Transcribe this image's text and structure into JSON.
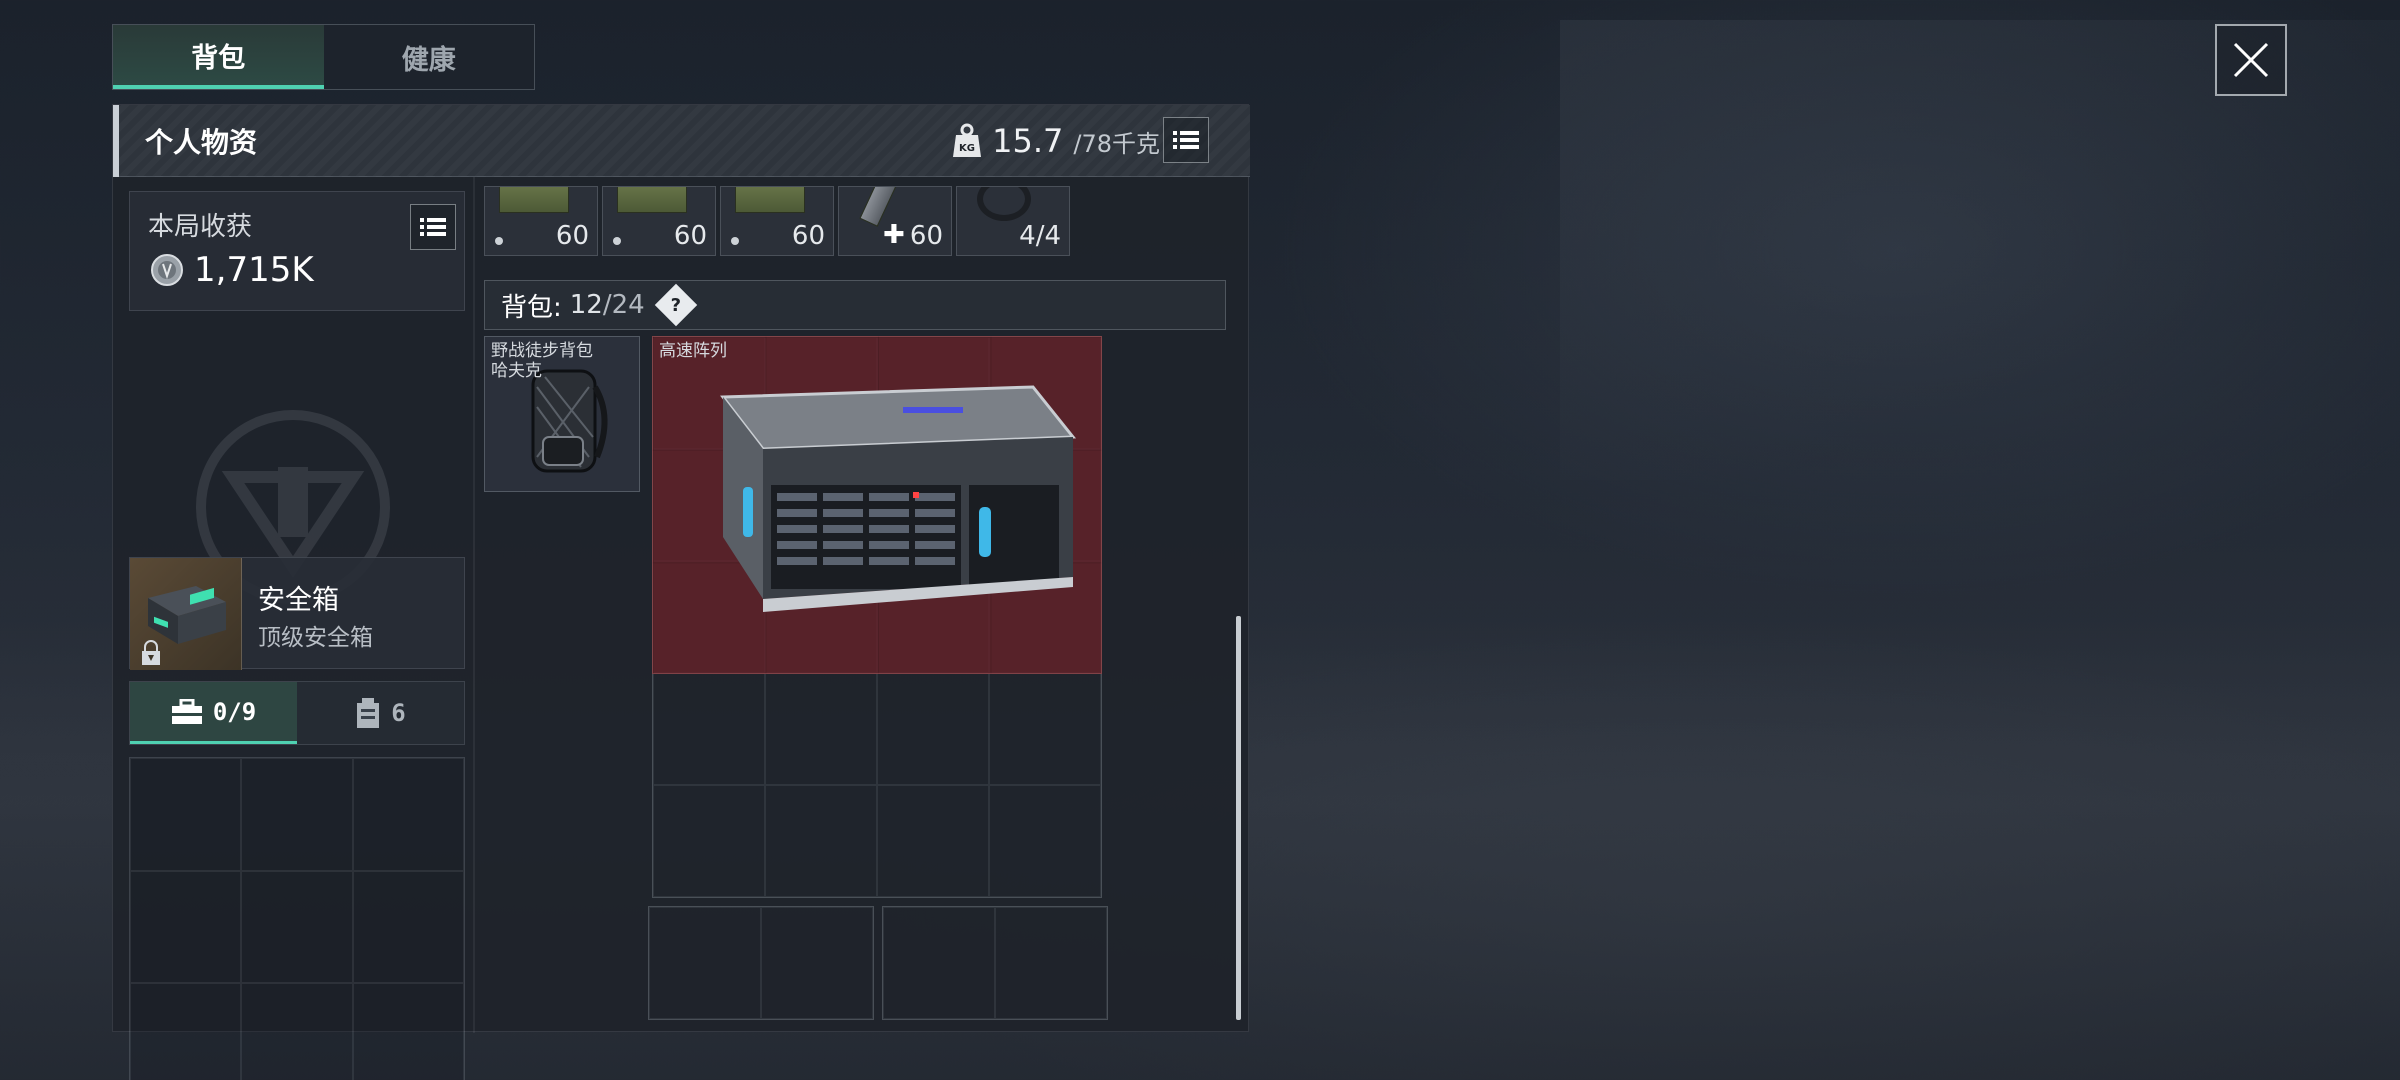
{
  "tabs": [
    {
      "label": "背包",
      "active": true
    },
    {
      "label": "健康",
      "active": false
    }
  ],
  "panel": {
    "title": "个人物资",
    "weight_current": "15.7",
    "weight_max": "/78千克"
  },
  "harvest": {
    "label": "本局收获",
    "value": "1,715K"
  },
  "safebox": {
    "name": "安全箱",
    "subtitle": "顶级安全箱"
  },
  "sub_tabs": [
    {
      "label": "0/9",
      "icon": "toolbox-icon",
      "active": true
    },
    {
      "label": "6",
      "icon": "container-icon",
      "active": false
    }
  ],
  "ammo_slots": [
    {
      "count": "60",
      "kind": "ammo"
    },
    {
      "count": "60",
      "kind": "ammo"
    },
    {
      "count": "60",
      "kind": "ammo"
    },
    {
      "count": "60",
      "kind": "medical"
    },
    {
      "count": "4/4",
      "kind": "gear"
    }
  ],
  "bag": {
    "label": "背包:",
    "count": "12",
    "capacity": "/24",
    "help": "?"
  },
  "backpack_item": {
    "label": "野战徒步背包\n哈夫克"
  },
  "raid_item": {
    "label": "高速阵列"
  },
  "colors": {
    "accent": "#4fd1b1",
    "item_highlight": "#6e242c"
  }
}
